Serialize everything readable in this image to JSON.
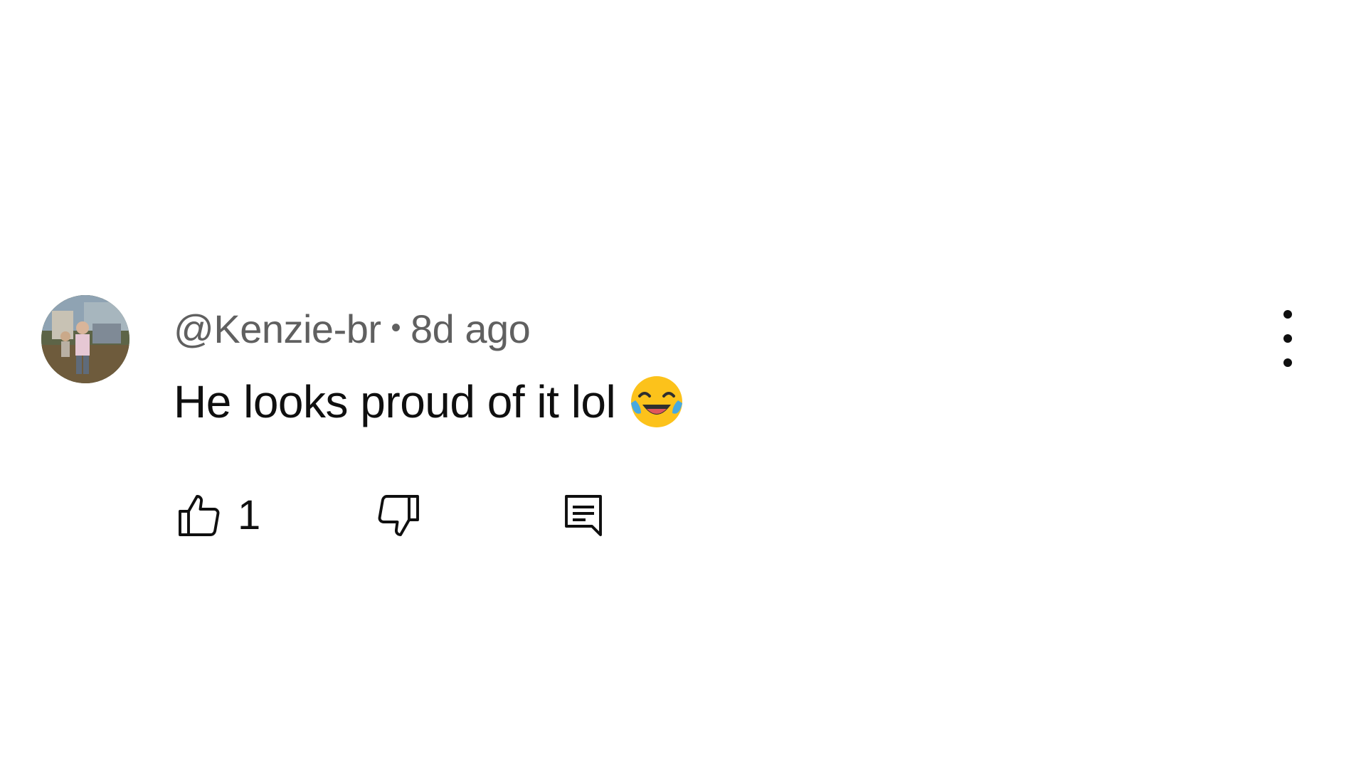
{
  "comment": {
    "author": "@Kenzie-br",
    "separator": "•",
    "time": "8d ago",
    "text": "He looks proud of it lol",
    "emoji": "face-with-tears-of-joy",
    "like_count": "1"
  },
  "icons": {
    "like": "thumbs-up-icon",
    "dislike": "thumbs-down-icon",
    "reply": "reply-comment-icon",
    "more": "more-vertical-icon"
  },
  "colors": {
    "text_primary": "#0f0f0f",
    "text_secondary": "#606060",
    "background": "#ffffff"
  }
}
